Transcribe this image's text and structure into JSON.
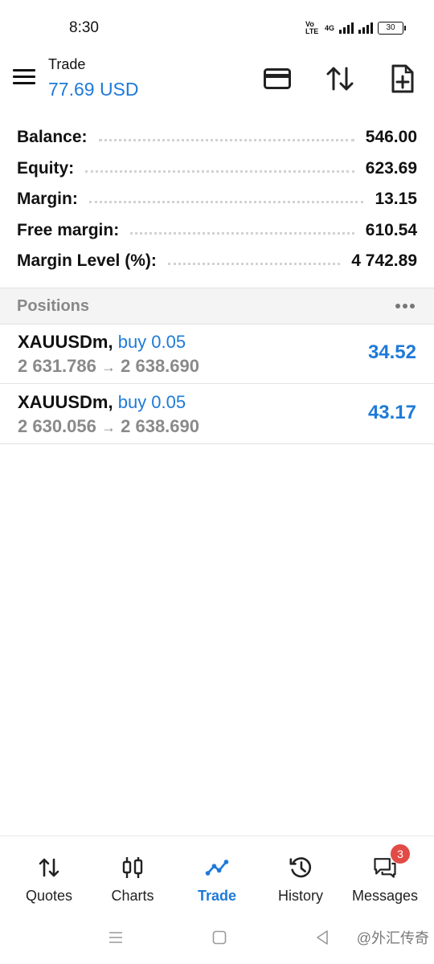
{
  "status_bar": {
    "time": "8:30",
    "network": "4G",
    "volte": "Vo LTE",
    "battery": "30"
  },
  "header": {
    "title": "Trade",
    "subtitle": "77.69 USD",
    "icons": [
      "menu-icon",
      "deposit-card-icon",
      "sort-icon",
      "new-order-icon"
    ]
  },
  "summary": [
    {
      "label": "Balance:",
      "value": "546.00"
    },
    {
      "label": "Equity:",
      "value": "623.69"
    },
    {
      "label": "Margin:",
      "value": "13.15"
    },
    {
      "label": "Free margin:",
      "value": "610.54"
    },
    {
      "label": "Margin Level (%):",
      "value": "4 742.89"
    }
  ],
  "positions": {
    "title": "Positions",
    "items": [
      {
        "symbol": "XAUUSDm,",
        "side": "buy 0.05",
        "open_price": "2 631.786",
        "arrow": "→",
        "current_price": "2 638.690",
        "profit": "34.52"
      },
      {
        "symbol": "XAUUSDm,",
        "side": "buy 0.05",
        "open_price": "2 630.056",
        "arrow": "→",
        "current_price": "2 638.690",
        "profit": "43.17"
      }
    ]
  },
  "bottom_nav": {
    "active": "Trade",
    "items": [
      {
        "label": "Quotes",
        "icon": "quotes-arrows-icon"
      },
      {
        "label": "Charts",
        "icon": "candlestick-icon"
      },
      {
        "label": "Trade",
        "icon": "trade-line-icon"
      },
      {
        "label": "History",
        "icon": "history-clock-icon"
      },
      {
        "label": "Messages",
        "icon": "chat-bubbles-icon",
        "badge": "3"
      }
    ]
  },
  "system_nav": {
    "watermark": "@外汇传奇"
  },
  "colors": {
    "accent": "#1e7ad8",
    "muted_text": "#8a8a8a",
    "badge": "#e24b45",
    "section_bg": "#f4f4f4"
  }
}
